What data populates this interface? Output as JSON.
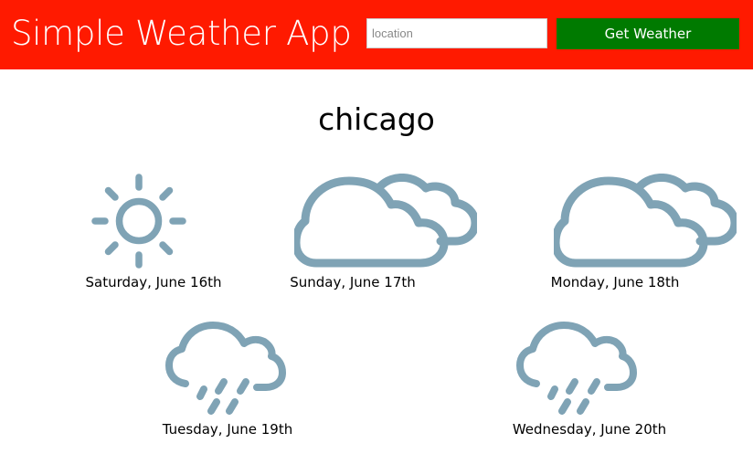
{
  "header": {
    "title": "Simple Weather App",
    "search_placeholder": "location",
    "search_value": "",
    "button_label": "Get Weather"
  },
  "city": "chicago",
  "forecast": [
    {
      "label": "Saturday, June 16th",
      "icon": "sun-icon"
    },
    {
      "label": "Sunday, June 17th",
      "icon": "cloudy-icon"
    },
    {
      "label": "Monday, June 18th",
      "icon": "cloudy-icon"
    },
    {
      "label": "Tuesday, June 19th",
      "icon": "rain-icon"
    },
    {
      "label": "Wednesday, June 20th",
      "icon": "rain-icon"
    }
  ],
  "colors": {
    "header": "#ff1a00",
    "button": "#007a00",
    "icon": "#7fa3b5"
  }
}
